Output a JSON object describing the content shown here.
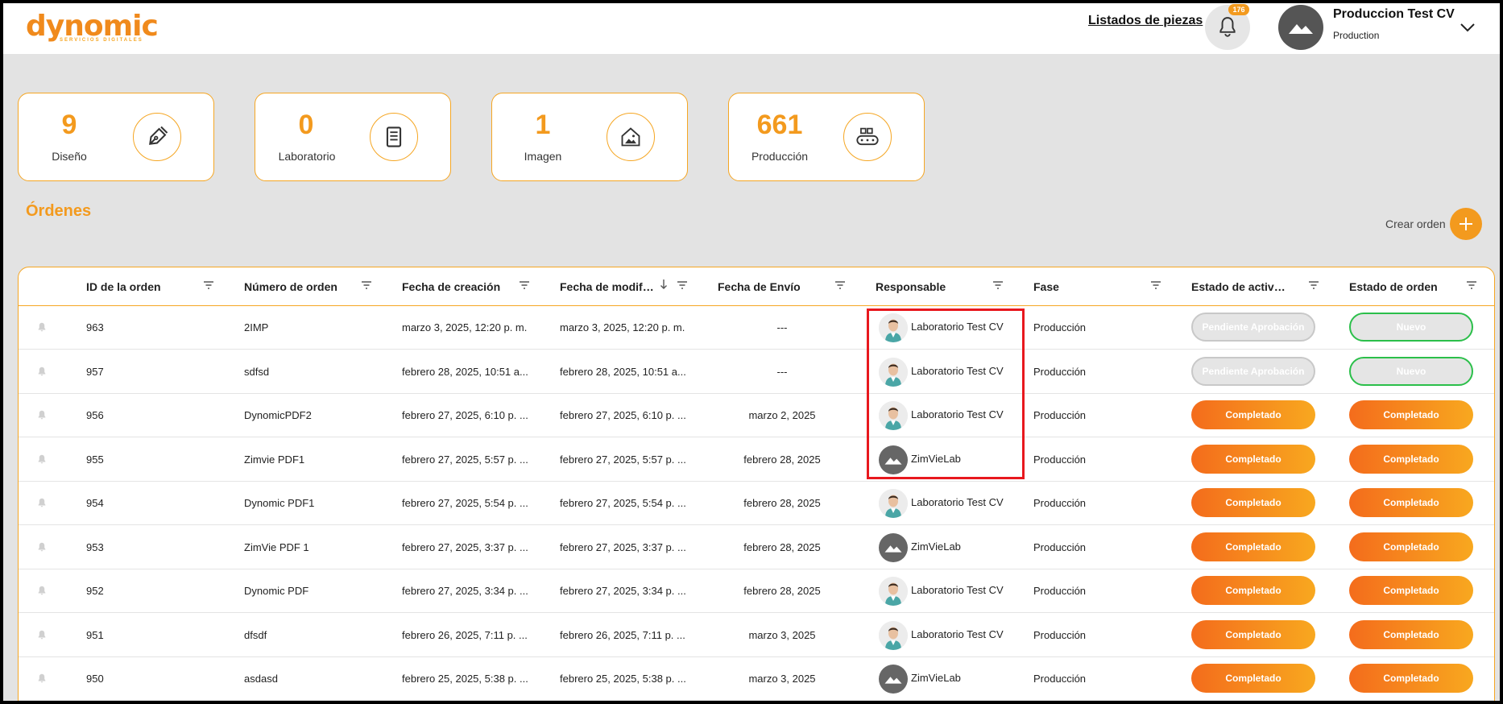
{
  "header": {
    "logo_text": "dynomic",
    "logo_subtext": "SERVICIOS DIGITALES",
    "nav_link": "Listados de piezas",
    "notification_count": "176",
    "user_name": "Produccion Test CV",
    "user_role": "Production"
  },
  "stats": [
    {
      "value": "9",
      "label": "Diseño",
      "icon": "pen-nib-icon"
    },
    {
      "value": "0",
      "label": "Laboratorio",
      "icon": "document-icon"
    },
    {
      "value": "1",
      "label": "Imagen",
      "icon": "house-image-icon"
    },
    {
      "value": "661",
      "label": "Producción",
      "icon": "conveyor-icon"
    }
  ],
  "orders": {
    "title": "Órdenes",
    "create_label": "Crear orden",
    "columns": [
      "ID de la orden",
      "Número de orden",
      "Fecha de creación",
      "Fecha de modificación",
      "Fecha de Envío",
      "Responsable",
      "Fase",
      "Estado de actividad",
      "Estado de orden"
    ],
    "rows": [
      {
        "id": "963",
        "number": "2IMP",
        "created": "marzo 3, 2025, 12:20 p. m.",
        "modified": "marzo 3, 2025, 12:20 p. m.",
        "sent": "---",
        "responsible": "Laboratorio Test CV",
        "avatar": "photo",
        "phase": "Producción",
        "activity": "Pendiente Aprobación",
        "status": "Nuevo"
      },
      {
        "id": "957",
        "number": "sdfsd",
        "created": "febrero 28, 2025, 10:51 a...",
        "modified": "febrero 28, 2025, 10:51 a...",
        "sent": "---",
        "responsible": "Laboratorio Test CV",
        "avatar": "photo",
        "phase": "Producción",
        "activity": "Pendiente Aprobación",
        "status": "Nuevo"
      },
      {
        "id": "956",
        "number": "DynomicPDF2",
        "created": "febrero 27, 2025, 6:10 p. ...",
        "modified": "febrero 27, 2025, 6:10 p. ...",
        "sent": "marzo 2, 2025",
        "responsible": "Laboratorio Test CV",
        "avatar": "photo",
        "phase": "Producción",
        "activity": "Completado",
        "status": "Completado"
      },
      {
        "id": "955",
        "number": "Zimvie PDF1",
        "created": "febrero 27, 2025, 5:57 p. ...",
        "modified": "febrero 27, 2025, 5:57 p. ...",
        "sent": "febrero 28, 2025",
        "responsible": "ZimVieLab",
        "avatar": "default",
        "phase": "Producción",
        "activity": "Completado",
        "status": "Completado"
      },
      {
        "id": "954",
        "number": "Dynomic PDF1",
        "created": "febrero 27, 2025, 5:54 p. ...",
        "modified": "febrero 27, 2025, 5:54 p. ...",
        "sent": "febrero 28, 2025",
        "responsible": "Laboratorio Test CV",
        "avatar": "photo",
        "phase": "Producción",
        "activity": "Completado",
        "status": "Completado"
      },
      {
        "id": "953",
        "number": "ZimVie PDF 1",
        "created": "febrero 27, 2025, 3:37 p. ...",
        "modified": "febrero 27, 2025, 3:37 p. ...",
        "sent": "febrero 28, 2025",
        "responsible": "ZimVieLab",
        "avatar": "default",
        "phase": "Producción",
        "activity": "Completado",
        "status": "Completado"
      },
      {
        "id": "952",
        "number": "Dynomic PDF",
        "created": "febrero 27, 2025, 3:34 p. ...",
        "modified": "febrero 27, 2025, 3:34 p. ...",
        "sent": "febrero 28, 2025",
        "responsible": "Laboratorio Test CV",
        "avatar": "photo",
        "phase": "Producción",
        "activity": "Completado",
        "status": "Completado"
      },
      {
        "id": "951",
        "number": "dfsdf",
        "created": "febrero 26, 2025, 7:11 p. ...",
        "modified": "febrero 26, 2025, 7:11 p. ...",
        "sent": "marzo 3, 2025",
        "responsible": "Laboratorio Test CV",
        "avatar": "photo",
        "phase": "Producción",
        "activity": "Completado",
        "status": "Completado"
      },
      {
        "id": "950",
        "number": "asdasd",
        "created": "febrero 25, 2025, 5:38 p. ...",
        "modified": "febrero 25, 2025, 5:38 p. ...",
        "sent": "marzo 3, 2025",
        "responsible": "ZimVieLab",
        "avatar": "default",
        "phase": "Producción",
        "activity": "Completado",
        "status": "Completado"
      }
    ]
  },
  "colors": {
    "accent": "#f39a1e",
    "highlight": "#e8181e",
    "new_border": "#2bbf4a"
  }
}
